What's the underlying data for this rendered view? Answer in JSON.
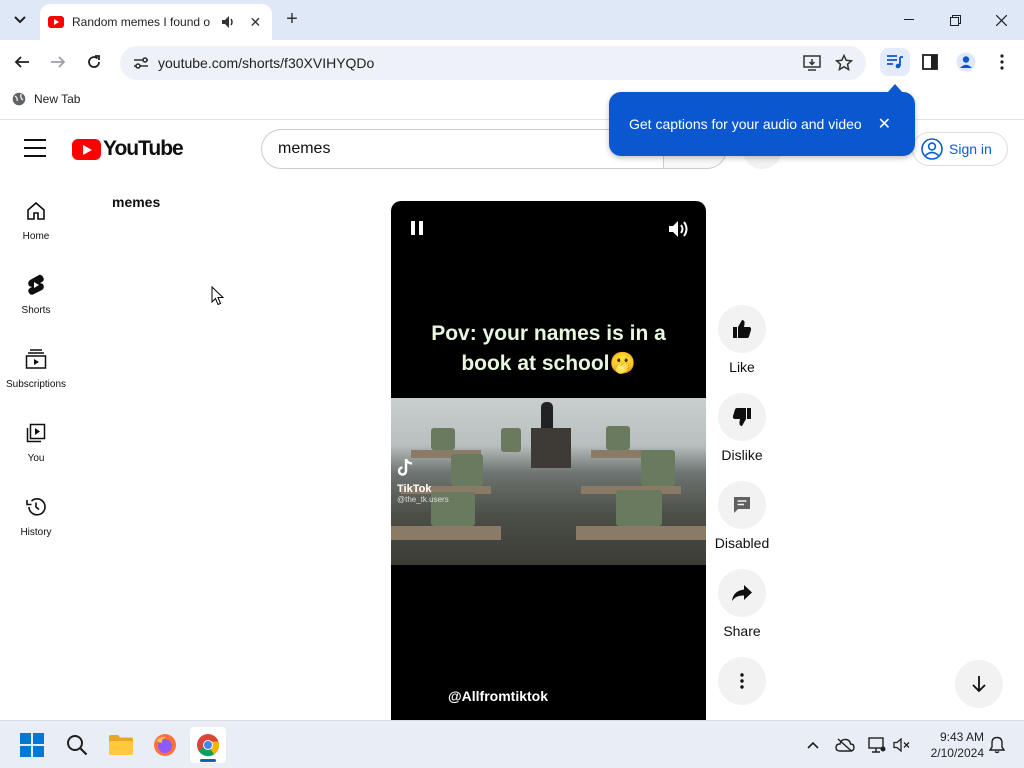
{
  "browser": {
    "tab": {
      "title": "Random memes I found on"
    },
    "omnibox": {
      "url": "youtube.com/shorts/f30XVIHYQDo"
    },
    "bookmarks": [
      {
        "label": "New Tab"
      }
    ],
    "captions_popup": {
      "text": "Get captions for your audio and video"
    }
  },
  "youtube": {
    "logo_text": "YouTube",
    "search": {
      "value": "memes"
    },
    "signin_label": "Sign in",
    "guide": [
      {
        "label": "Home",
        "icon": "home-icon"
      },
      {
        "label": "Shorts",
        "icon": "shorts-icon"
      },
      {
        "label": "Subscriptions",
        "icon": "subscriptions-icon"
      },
      {
        "label": "You",
        "icon": "you-icon"
      },
      {
        "label": "History",
        "icon": "history-icon"
      }
    ],
    "chip_label": "memes",
    "short": {
      "caption_line1": "Pov: your names is in a",
      "caption_line2": "book at school🫢",
      "watermark_name": "TikTok",
      "watermark_user": "@the_tk.users",
      "channel": "@Allfromtiktok"
    },
    "actions": [
      {
        "label": "Like",
        "icon": "thumbs-up-icon"
      },
      {
        "label": "Dislike",
        "icon": "thumbs-down-icon"
      },
      {
        "label": "Disabled",
        "icon": "comments-icon"
      },
      {
        "label": "Share",
        "icon": "share-icon"
      },
      {
        "label": "",
        "icon": "more-vert-icon"
      }
    ]
  },
  "taskbar": {
    "time": "9:43 AM",
    "date": "2/10/2024"
  },
  "colors": {
    "youtube_red": "#ff0000",
    "popup_blue": "#0b57d0",
    "link_blue": "#065fd4",
    "tabstrip": "#dfe8f7"
  }
}
